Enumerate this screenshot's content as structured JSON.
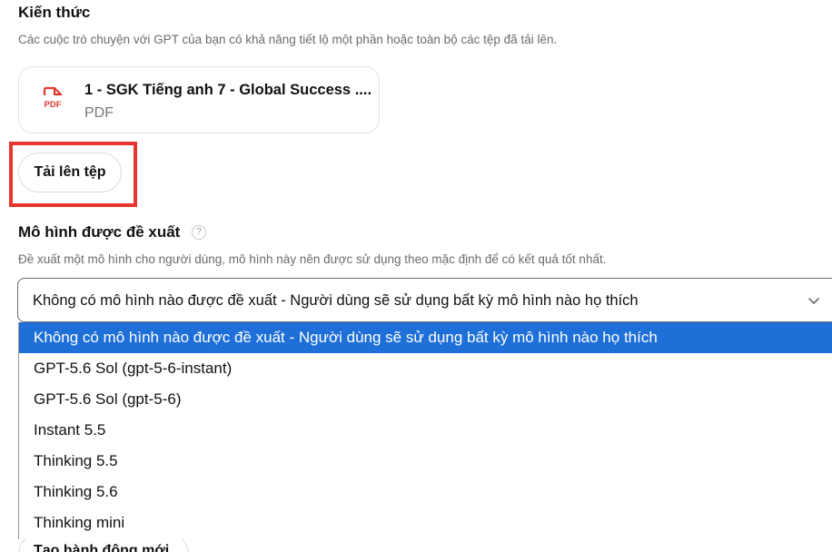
{
  "knowledge": {
    "title": "Kiến thức",
    "description": "Các cuộc trò chuyện với GPT của bạn có khả năng tiết lộ một phần hoặc toàn bộ các tệp đã tải lên.",
    "file": {
      "icon": "pdf-file-icon",
      "icon_label": "PDF",
      "name": "1 - SGK Tiếng anh 7 - Global Success ....",
      "type": "PDF"
    },
    "upload_label": "Tải lên tệp",
    "highlight_color": "#e8352f"
  },
  "recommended_model": {
    "title": "Mô hình được đề xuất",
    "help_icon": "?",
    "description": "Đề xuất một mô hình cho người dùng, mô hình này nên được sử dụng theo mặc định để có kết quả tốt nhất.",
    "selected_value": "Không có mô hình nào được đề xuất - Người dùng sẽ sử dụng bất kỳ mô hình nào họ thích",
    "options": [
      "Không có mô hình nào được đề xuất - Người dùng sẽ sử dụng bất kỳ mô hình nào họ thích",
      "GPT-5.6 Sol (gpt-5-6-instant)",
      "GPT-5.6 Sol (gpt-5-6)",
      "Instant 5.5",
      "Thinking 5.5",
      "Thinking 5.6",
      "Thinking mini"
    ],
    "selected_color": "#1f6fd8"
  },
  "actions": {
    "create_action_label": "Tạo hành động mới"
  }
}
